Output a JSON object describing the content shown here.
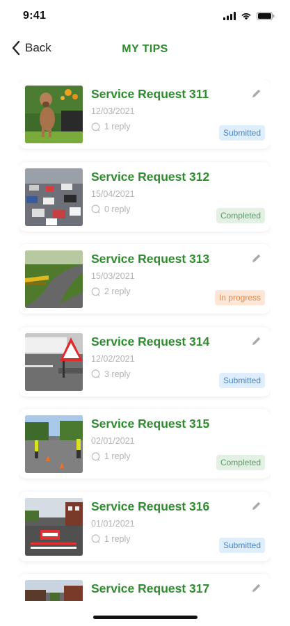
{
  "status_bar": {
    "time": "9:41"
  },
  "nav": {
    "back_label": "Back",
    "title": "MY TIPS"
  },
  "requests": [
    {
      "title": "Service Request 311",
      "date": "12/03/2021",
      "replies": "1 reply",
      "status": "Submitted",
      "image": "dog"
    },
    {
      "title": "Service Request 312",
      "date": "15/04/2021",
      "replies": "0 reply",
      "status": "Completed",
      "image": "traffic-jam"
    },
    {
      "title": "Service Request 313",
      "date": "15/03/2021",
      "replies": "2 reply",
      "status": "In progress",
      "image": "curved-road"
    },
    {
      "title": "Service Request 314",
      "date": "12/02/2021",
      "replies": "3 reply",
      "status": "Submitted",
      "image": "road-sign"
    },
    {
      "title": "Service Request 315",
      "date": "02/01/2021",
      "replies": "1 reply",
      "status": "Completed",
      "image": "road-workers"
    },
    {
      "title": "Service Request 316",
      "date": "01/01/2021",
      "replies": "1 reply",
      "status": "Submitted",
      "image": "road-closed"
    },
    {
      "title": "Service Request 317",
      "date": "",
      "replies": "",
      "status": "",
      "image": "houses-street"
    }
  ],
  "colors": {
    "accent_green": "#2e8b2e",
    "submitted_bg": "#deeefd",
    "completed_bg": "#e2f1e4",
    "inprogress_bg": "#fde6d5"
  },
  "icons": [
    "signal-icon",
    "wifi-icon",
    "battery-icon",
    "back-chevron-icon",
    "edit-pencil-icon",
    "comment-bubble-icon"
  ]
}
